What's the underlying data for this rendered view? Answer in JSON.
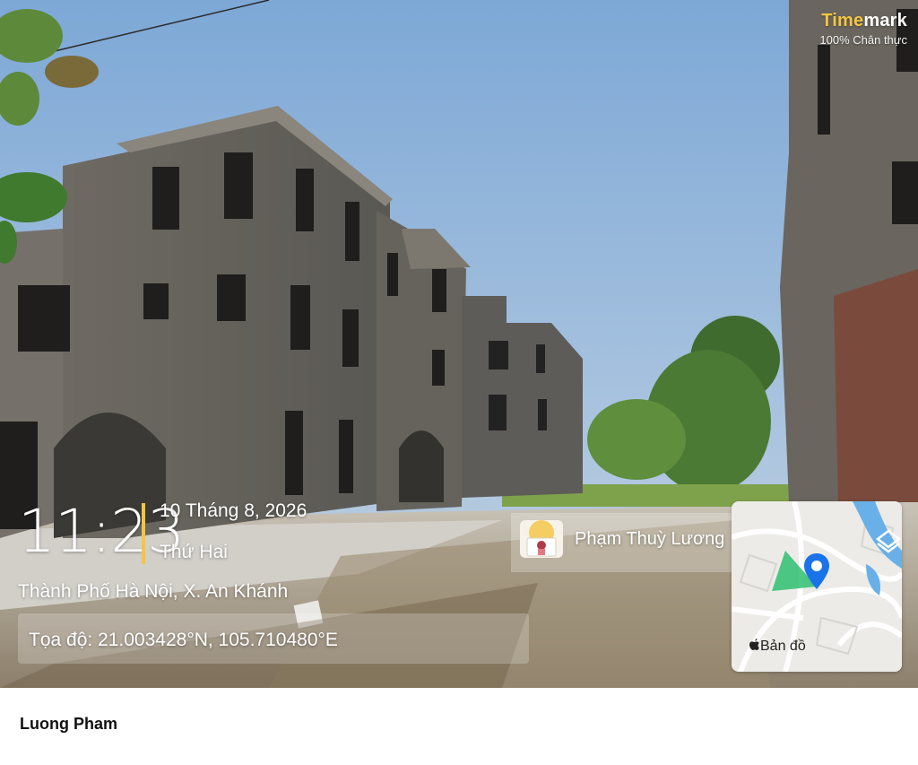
{
  "watermark": {
    "brand_part1": "Time",
    "brand_part2": "mark",
    "tagline": "100% Chân thực",
    "time": "11:23",
    "date": "10 Tháng 8, 2026",
    "weekday": "Thứ Hai",
    "location": "Thành Phố Hà Nội, X. An Khánh",
    "coordinates": "Tọa độ: 21.003428°N, 105.710480°E",
    "user_name": "Phạm Thuỳ Lương",
    "map_label": "Bản đồ",
    "accent_color": "#f4c542",
    "map_pin_color": "#1a73e8",
    "map_area_color": "#2fbf71"
  },
  "caption": {
    "author": "Luong Pham"
  },
  "scene": {
    "icons": [
      "map-pin-icon",
      "apple-logo-icon",
      "expand-layers-icon",
      "avatar-icon"
    ]
  }
}
